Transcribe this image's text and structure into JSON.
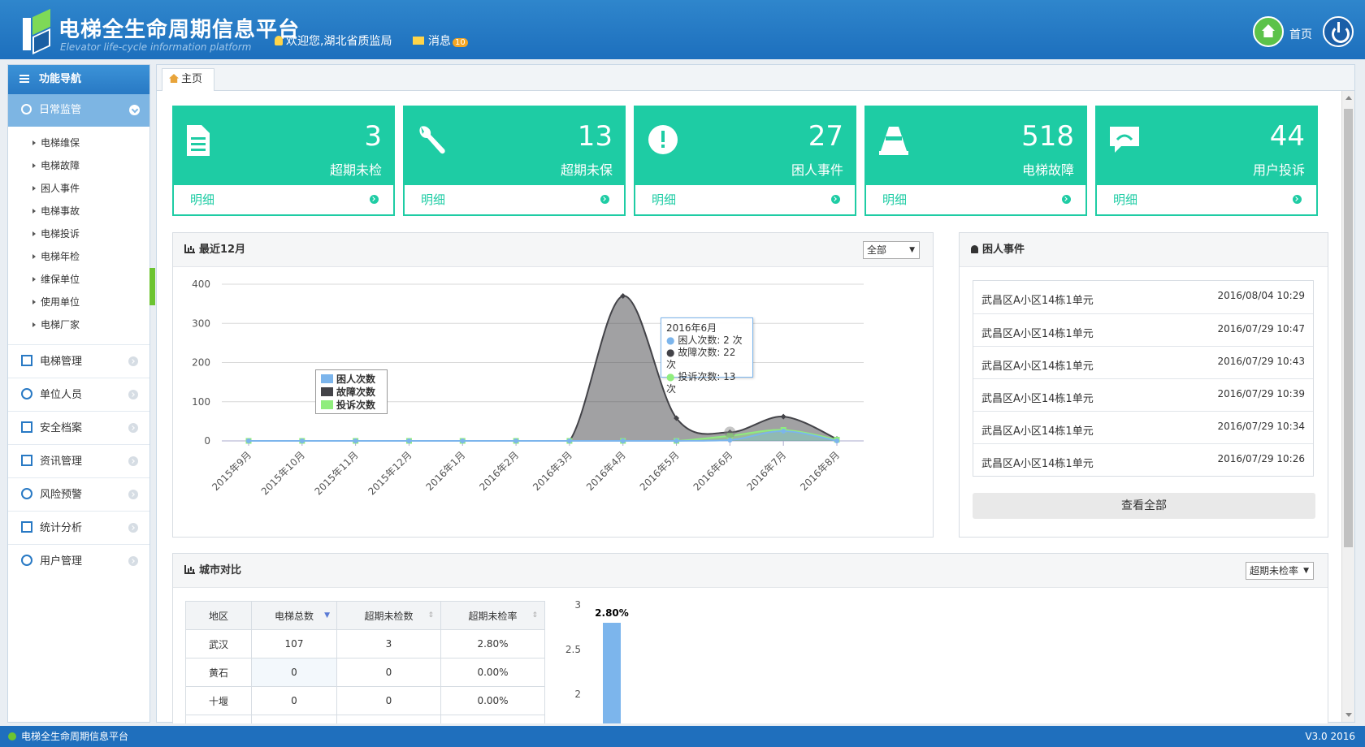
{
  "header": {
    "title": "电梯全生命周期信息平台",
    "subtitle": "Elevator life-cycle information platform",
    "welcome": "欢迎您,湖北省质监局",
    "messages_label": "消息",
    "messages_count": "10",
    "home_label": "首页"
  },
  "sidebar": {
    "heading": "功能导航",
    "active_section": "日常监管",
    "sub_items": [
      "电梯维保",
      "电梯故障",
      "困人事件",
      "电梯事故",
      "电梯投诉",
      "电梯年检",
      "维保单位",
      "使用单位",
      "电梯厂家"
    ],
    "sections": [
      "电梯管理",
      "单位人员",
      "安全档案",
      "资讯管理",
      "风险预警",
      "统计分析",
      "用户管理"
    ]
  },
  "tab": {
    "label": "主页"
  },
  "cards": [
    {
      "value": "3",
      "label": "超期未检",
      "link": "明细",
      "icon": "document-icon"
    },
    {
      "value": "13",
      "label": "超期未保",
      "link": "明细",
      "icon": "wrench-icon"
    },
    {
      "value": "27",
      "label": "困人事件",
      "link": "明细",
      "icon": "alert-icon"
    },
    {
      "value": "518",
      "label": "电梯故障",
      "link": "明细",
      "icon": "cone-icon"
    },
    {
      "value": "44",
      "label": "用户投诉",
      "link": "明细",
      "icon": "complaint-icon"
    }
  ],
  "recent_panel": {
    "title": "最近12月",
    "filter": "全部"
  },
  "events_panel": {
    "title": "困人事件",
    "items": [
      {
        "name": "武昌区A小区14栋1单元",
        "time": "2016/08/04 10:29"
      },
      {
        "name": "武昌区A小区14栋1单元",
        "time": "2016/07/29 10:47"
      },
      {
        "name": "武昌区A小区14栋1单元",
        "time": "2016/07/29 10:43"
      },
      {
        "name": "武昌区A小区14栋1单元",
        "time": "2016/07/29 10:39"
      },
      {
        "name": "武昌区A小区14栋1单元",
        "time": "2016/07/29 10:34"
      },
      {
        "name": "武昌区A小区14栋1单元",
        "time": "2016/07/29 10:26"
      }
    ],
    "view_all": "查看全部"
  },
  "city_panel": {
    "title": "城市对比",
    "filter": "超期未检率",
    "columns": [
      "地区",
      "电梯总数",
      "超期未检数",
      "超期未检率"
    ],
    "rows": [
      [
        "武汉",
        "107",
        "3",
        "2.80%"
      ],
      [
        "黄石",
        "0",
        "0",
        "0.00%"
      ],
      [
        "十堰",
        "0",
        "0",
        "0.00%"
      ]
    ]
  },
  "tooltip": {
    "title": "2016年6月",
    "lines": [
      "困人次数: 2 次",
      "故障次数: 22 次",
      "投诉次数: 13 次"
    ]
  },
  "chart_data": [
    {
      "type": "area",
      "categories": [
        "2015年9月",
        "2015年10月",
        "2015年11月",
        "2015年12月",
        "2016年1月",
        "2016年2月",
        "2016年3月",
        "2016年4月",
        "2016年5月",
        "2016年6月",
        "2016年7月",
        "2016年8月"
      ],
      "series": [
        {
          "name": "困人次数",
          "color": "#7cb5ec",
          "values": [
            0,
            0,
            0,
            0,
            0,
            0,
            0,
            0,
            0,
            2,
            25,
            0
          ]
        },
        {
          "name": "故障次数",
          "color": "#434348",
          "values": [
            0,
            0,
            0,
            0,
            0,
            0,
            0,
            370,
            58,
            22,
            62,
            5
          ]
        },
        {
          "name": "投诉次数",
          "color": "#90ed7d",
          "values": [
            0,
            0,
            0,
            0,
            0,
            0,
            0,
            0,
            0,
            13,
            28,
            3
          ]
        }
      ],
      "yticks": [
        0,
        100,
        200,
        300,
        400
      ],
      "ylim": [
        0,
        400
      ],
      "legend": "left"
    },
    {
      "type": "bar",
      "categories": [
        "武汉"
      ],
      "values": [
        2.8
      ],
      "data_labels": [
        "2.80%"
      ],
      "color": "#7cb5ec",
      "yticks": [
        "3",
        "2.5",
        "2"
      ],
      "ylim": [
        2,
        3
      ]
    }
  ]
}
